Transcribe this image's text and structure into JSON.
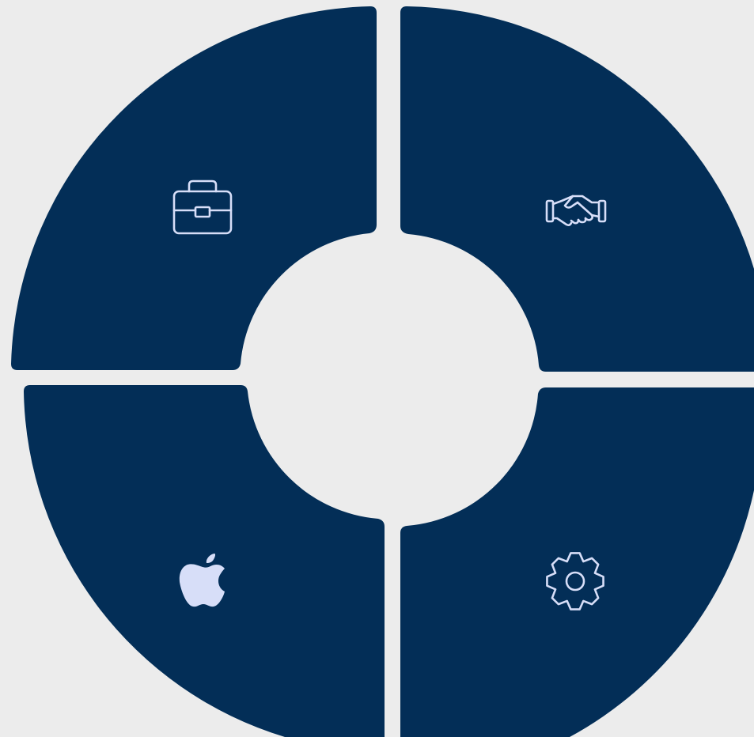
{
  "diagram": {
    "colors": {
      "background": "#ececec",
      "segment_fill": "#032e57",
      "icon_color": "#d7def8"
    },
    "segments": [
      {
        "id": "top-left",
        "icon": "briefcase-icon"
      },
      {
        "id": "top-right",
        "icon": "handshake-icon"
      },
      {
        "id": "bottom-left",
        "icon": "apple-icon"
      },
      {
        "id": "bottom-right",
        "icon": "gear-icon"
      }
    ]
  }
}
